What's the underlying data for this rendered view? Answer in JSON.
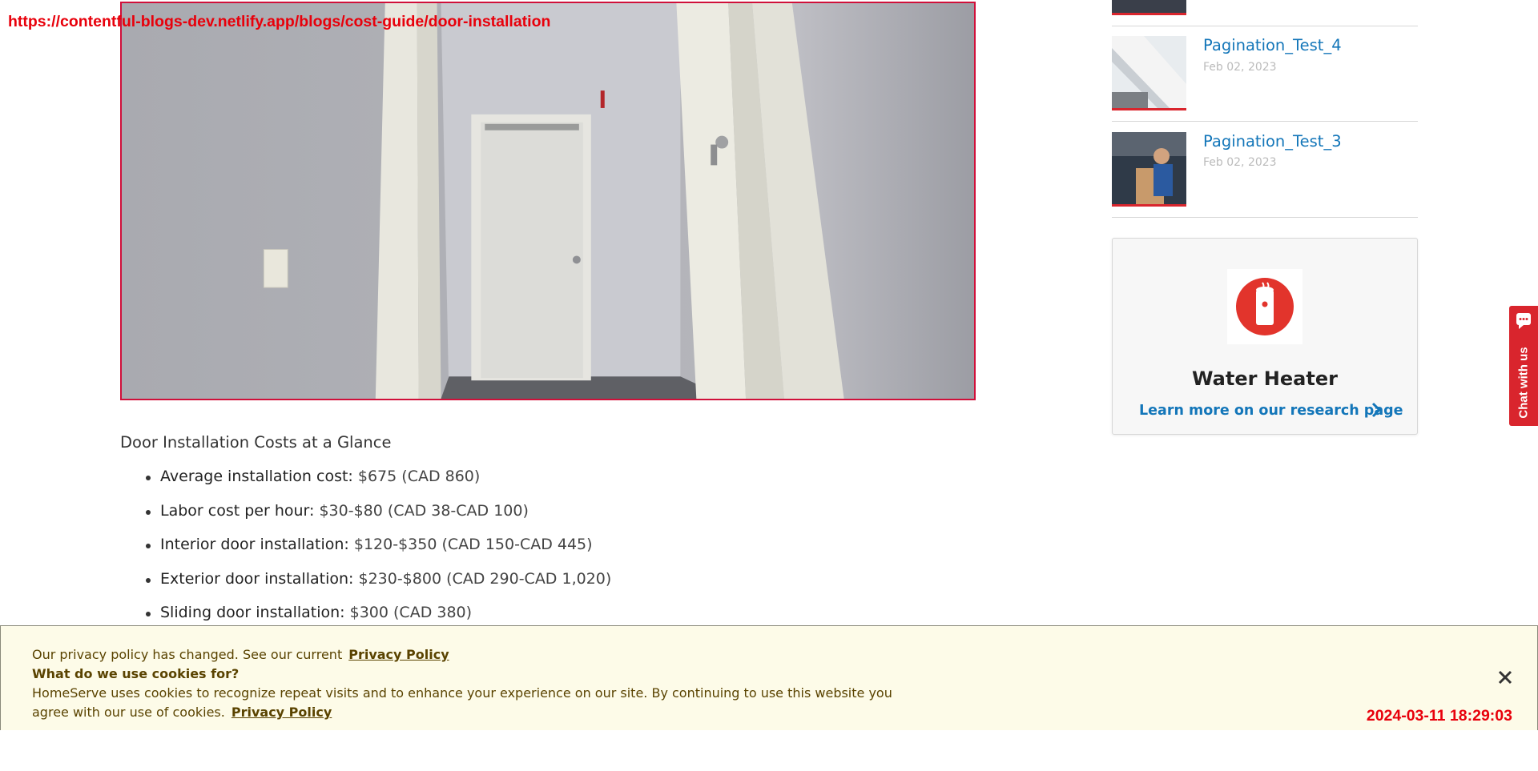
{
  "overlay": {
    "url": "https://contentful-blogs-dev.netlify.app/blogs/cost-guide/door-installation",
    "timestamp": "2024-03-11 18:29:03"
  },
  "article": {
    "summary_heading": "Door Installation Costs at a Glance",
    "costs": [
      {
        "label": "Average installation cost:",
        "value": " $675 (CAD 860)"
      },
      {
        "label": "Labor cost per hour:",
        "value": " $30-$80 (CAD 38-CAD 100)"
      },
      {
        "label": "Interior door installation:",
        "value": " $120-$350 (CAD 150-CAD 445)"
      },
      {
        "label": "Exterior door installation:",
        "value": " $230-$800 (CAD 290-CAD 1,020)"
      },
      {
        "label": "Sliding door installation:",
        "value": " $300 (CAD 380)"
      }
    ]
  },
  "sidebar": {
    "posts": [
      {
        "title": "Pagination_Test_4",
        "date": "Feb 02, 2023"
      },
      {
        "title": "Pagination_Test_3",
        "date": "Feb 02, 2023"
      }
    ],
    "research_card": {
      "title": "Water Heater",
      "link": "Learn more on our research page",
      "icon": "water-heater-icon"
    }
  },
  "chat": {
    "label": "Chat with us",
    "icon": "chat-icon"
  },
  "cookie_banner": {
    "line1": "Our privacy policy has changed. See our current",
    "line1_link": "Privacy Policy",
    "question": "What do we use cookies for?",
    "line3": "HomeServe uses cookies to recognize repeat visits and to enhance your experience on our site. By continuing to use this website you",
    "line4": "agree with our use of cookies.",
    "line4_link": "Privacy Policy",
    "close_icon": "close-icon"
  },
  "colors": {
    "brand_red": "#d9252d",
    "link_blue": "#1376b9",
    "banner_bg": "#fdfbe8",
    "banner_text": "#5a4300",
    "overlay_red": "#e8000b"
  }
}
